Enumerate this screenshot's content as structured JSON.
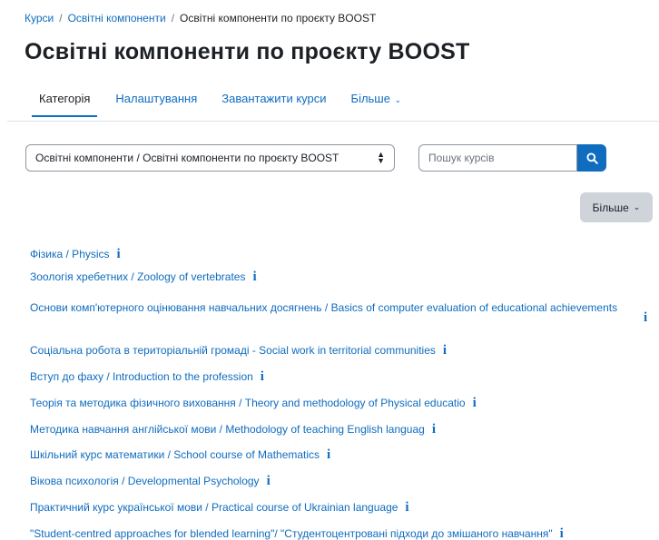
{
  "breadcrumb": {
    "items": [
      "Курси",
      "Освітні компоненти"
    ],
    "separator": "/",
    "current": "Освітні компоненти по проєкту BOOST"
  },
  "page_title": "Освітні компоненти по проєкту BOOST",
  "tabs": [
    {
      "label": "Категорія",
      "active": true
    },
    {
      "label": "Налаштування"
    },
    {
      "label": "Завантажити курси"
    },
    {
      "label": "Більше"
    }
  ],
  "category_select": {
    "value": "Освітні компоненти / Освітні компоненти по проєкту BOOST"
  },
  "search": {
    "placeholder": "Пошук курсів"
  },
  "more_button": {
    "label": "Більше"
  },
  "info_glyph": "i",
  "courses": [
    {
      "title": "Фізика / Physics"
    },
    {
      "title": "Зоологія хребетних / Zoology of vertebrates"
    },
    {
      "title": "Основи комп'ютерного оцінювання навчальних досягнень / Basics of computer evaluation of educational achievements"
    },
    {
      "title": "Соціальна робота в територіальній громаді - Social work in territorial communities"
    },
    {
      "title": "Вступ до фаху / Introduction to the profession"
    },
    {
      "title": "Теорія та методика фізичного виховання / Theory and methodology of Physical educatio"
    },
    {
      "title": "Методика навчання англійської мови / Methodology of teaching English languag"
    },
    {
      "title": "Шкільний курс математики / School course of Mathematics"
    },
    {
      "title": "Вікова психологія / Developmental Psychology"
    },
    {
      "title": "Практичний курс української мови / Practical course of Ukrainian language"
    },
    {
      "title": "\"Student-centred approaches for blended learning\"/ \"Студентоцентровані підходи до змішаного навчання\""
    }
  ],
  "colors": {
    "link": "#0f6cbf",
    "text": "#1d2125",
    "button_primary": "#0f6cbf",
    "button_secondary": "#ced4da"
  }
}
